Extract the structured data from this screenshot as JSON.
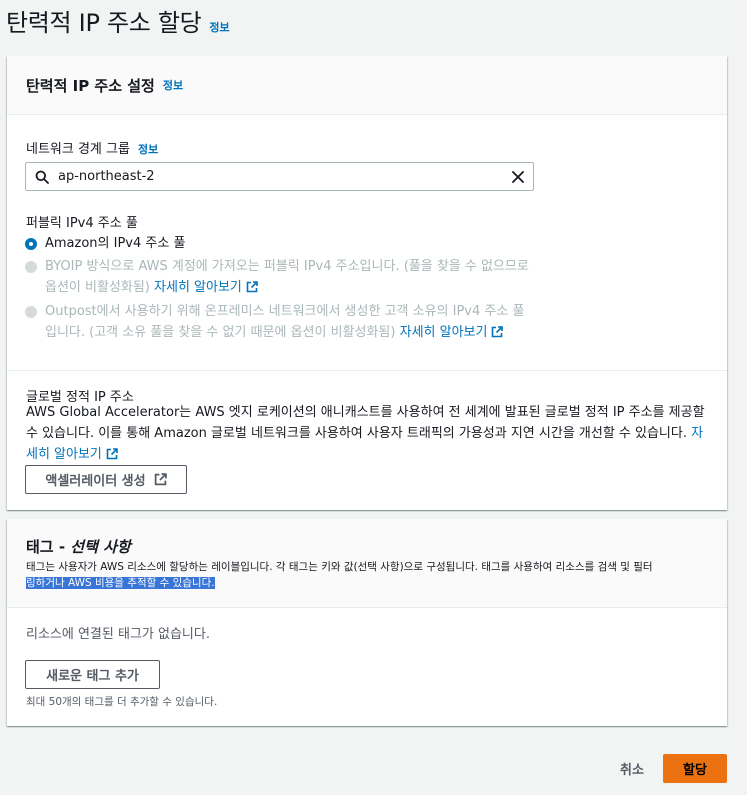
{
  "page": {
    "title": "탄력적 IP 주소 할당",
    "info": "정보"
  },
  "settings_panel": {
    "title": "탄력적 IP 주소 설정",
    "info": "정보",
    "network_border_group": {
      "label": "네트워크 경계 그룹",
      "info": "정보",
      "value": "ap-northeast-2"
    },
    "public_ipv4_pool": {
      "label": "퍼블릭 IPv4 주소 풀",
      "options": [
        {
          "text": "Amazon의 IPv4 주소 풀",
          "selected": true,
          "disabled": false
        },
        {
          "text": "BYOIP 방식으로 AWS 계정에 가져오는 퍼블릭 IPv4 주소입니다. (풀을 찾을 수 없으므로 옵션이 비활성화됨)",
          "link": "자세히 알아보기",
          "selected": false,
          "disabled": true
        },
        {
          "text": "Outpost에서 사용하기 위해 온프레미스 네트워크에서 생성한 고객 소유의 IPv4 주소 풀입니다. (고객 소유 풀을 찾을 수 없기 때문에 옵션이 비활성화됨)",
          "link": "자세히 알아보기",
          "selected": false,
          "disabled": true
        }
      ]
    },
    "global_static_ip": {
      "label": "글로벌 정적 IP 주소",
      "description": "AWS Global Accelerator는 AWS 엣지 로케이션의 애니캐스트를 사용하여 전 세계에 발표된 글로벌 정적 IP 주소를 제공할 수 있습니다. 이를 통해 Amazon 글로벌 네트워크를 사용하여 사용자 트래픽의 가용성과 지연 시간을 개선할 수 있습니다.",
      "link": "자세히 알아보기",
      "button": "액셀러레이터 생성"
    }
  },
  "tags_panel": {
    "title": "태그 - ",
    "title_optional": "선택 사항",
    "description": "태그는 사용자가 AWS 리소스에 할당하는 레이블입니다. 각 태그는 키와 값(선택 사항)으로 구성됩니다. 태그를 사용하여 리소스를 검색 및 필터",
    "description_highlight": "링하거나 AWS 비용을 추적할 수 있습니다.",
    "empty_text": "리소스에 연결된 태그가 없습니다.",
    "add_button": "새로운 태그 추가",
    "limit_text": "최대 50개의 태그를 더 추가할 수 있습니다."
  },
  "footer": {
    "cancel": "취소",
    "submit": "할당"
  },
  "colors": {
    "primary": "#ec7211",
    "link": "#0073bb",
    "highlight": "#3875d7"
  }
}
